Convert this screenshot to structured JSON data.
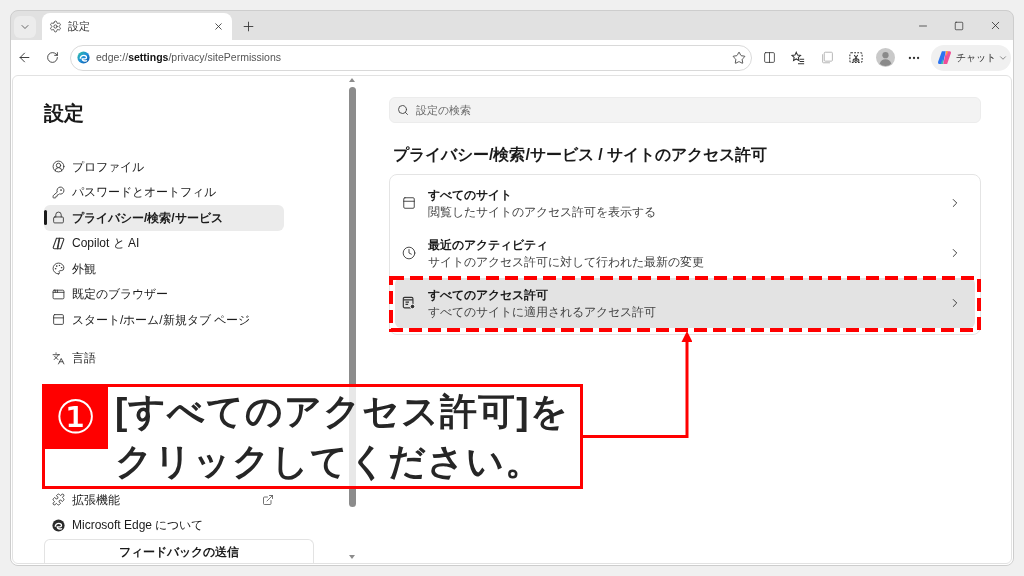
{
  "tab_strip": {
    "tabs": [
      {
        "title": "設定",
        "selected": true
      }
    ]
  },
  "toolbar": {
    "address": "edge://**settings**/privacy/sitePermissions",
    "chat_button": "チャット"
  },
  "sidebar": {
    "title": "設定",
    "sections": [
      {
        "items": [
          {
            "label": "プロファイル",
            "kind": "plain",
            "selected": false
          },
          {
            "label": "パスワードとオートフィル",
            "kind": "plain",
            "selected": false
          },
          {
            "label": "プライバシー/検索/サービス",
            "kind": "plain",
            "selected": true
          },
          {
            "label": "Copilot と AI",
            "kind": "plain",
            "selected": false
          },
          {
            "label": "外観",
            "kind": "plain",
            "selected": false
          },
          {
            "label": "既定のブラウザー",
            "kind": "plain",
            "selected": false
          },
          {
            "label": "スタート/ホーム/新規タブ ページ",
            "kind": "plain",
            "selected": false
          }
        ]
      },
      {
        "items": [
          {
            "label": "言語",
            "kind": "plain",
            "selected": false
          }
        ]
      },
      {
        "items": [
          {
            "label": "拡張機能",
            "kind": "external",
            "selected": false
          },
          {
            "label": "Microsoft Edge について",
            "kind": "plain",
            "selected": false
          }
        ]
      }
    ],
    "feedback_button": "フィードバックの送信"
  },
  "main": {
    "search": {
      "placeholder": "設定の検索"
    },
    "heading": "プライバシー/検索/サービス / サイトのアクセス許可",
    "rows": [
      {
        "title": "すべてのサイト",
        "subtitle": "閲覧したサイトのアクセス許可を表示する",
        "highlighted": false,
        "marked": false
      },
      {
        "title": "最近のアクティビティ",
        "subtitle": "サイトのアクセス許可に対して行われた最新の変更",
        "highlighted": false,
        "marked": false
      },
      {
        "title": "すべてのアクセス許可",
        "subtitle": "すべてのサイトに適用されるアクセス許可",
        "highlighted": true,
        "marked": true
      }
    ]
  },
  "callout": {
    "number": "①",
    "lines": [
      "[すべてのアクセス許可]を",
      "クリックしてください。"
    ]
  }
}
